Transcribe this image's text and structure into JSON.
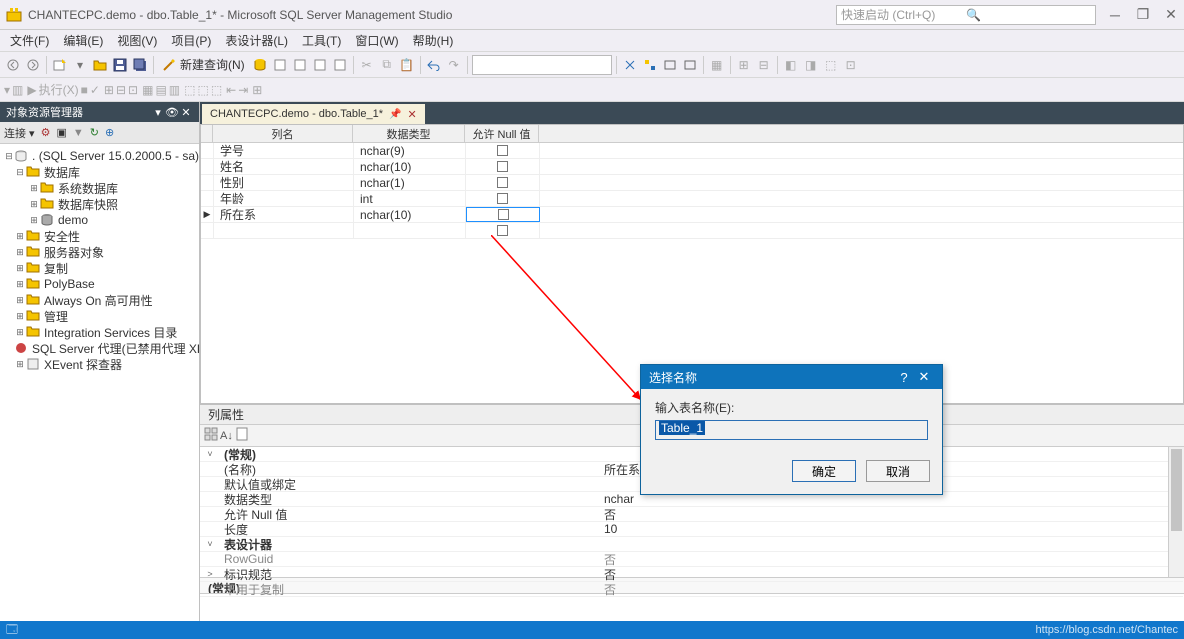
{
  "title": "CHANTECPC.demo - dbo.Table_1* - Microsoft SQL Server Management Studio",
  "quick_launch_placeholder": "快速启动 (Ctrl+Q)",
  "menu": [
    "文件(F)",
    "编辑(E)",
    "视图(V)",
    "项目(P)",
    "表设计器(L)",
    "工具(T)",
    "窗口(W)",
    "帮助(H)"
  ],
  "toolbar": {
    "new_query": "新建查询(N)",
    "execute": "执行(X)"
  },
  "explorer": {
    "title": "对象资源管理器",
    "connect": "连接",
    "root": ". (SQL Server 15.0.2000.5 - sa)",
    "nodes": {
      "databases": "数据库",
      "sysdb": "系统数据库",
      "snapshots": "数据库快照",
      "demo": "demo",
      "security": "安全性",
      "serverobjects": "服务器对象",
      "replication": "复制",
      "polybase": "PolyBase",
      "alwayson": "Always On 高可用性",
      "management": "管理",
      "integration": "Integration Services 目录",
      "agent": "SQL Server 代理(已禁用代理 XP)",
      "xevent": "XEvent 探查器"
    }
  },
  "tab": {
    "label": "CHANTECPC.demo - dbo.Table_1*"
  },
  "grid": {
    "headers": {
      "col": "列名",
      "type": "数据类型",
      "null": "允许 Null 值"
    },
    "rows": [
      {
        "col": "学号",
        "type": "nchar(9)",
        "null": false
      },
      {
        "col": "姓名",
        "type": "nchar(10)",
        "null": false
      },
      {
        "col": "性别",
        "type": "nchar(1)",
        "null": false
      },
      {
        "col": "年龄",
        "type": "int",
        "null": false
      },
      {
        "col": "所在系",
        "type": "nchar(10)",
        "null": false,
        "selected": true
      }
    ]
  },
  "props": {
    "title": "列属性",
    "cat_general": "(常规)",
    "name_k": "(名称)",
    "name_v": "所在系",
    "default_k": "默认值或绑定",
    "default_v": "",
    "dtype_k": "数据类型",
    "dtype_v": "nchar",
    "allow_k": "允许 Null 值",
    "allow_v": "否",
    "len_k": "长度",
    "len_v": "10",
    "cat_designer": "表设计器",
    "rowguid_k": "RowGuid",
    "rowguid_v": "否",
    "ident_k": "标识规范",
    "ident_v": "否",
    "notrepl_k": "不用于复制",
    "notrepl_v": "否",
    "desc": "(常规)"
  },
  "dialog": {
    "title": "选择名称",
    "label": "输入表名称(E):",
    "value": "Table_1",
    "ok": "确定",
    "cancel": "取消"
  },
  "watermark": "https://blog.csdn.net/Chantec"
}
